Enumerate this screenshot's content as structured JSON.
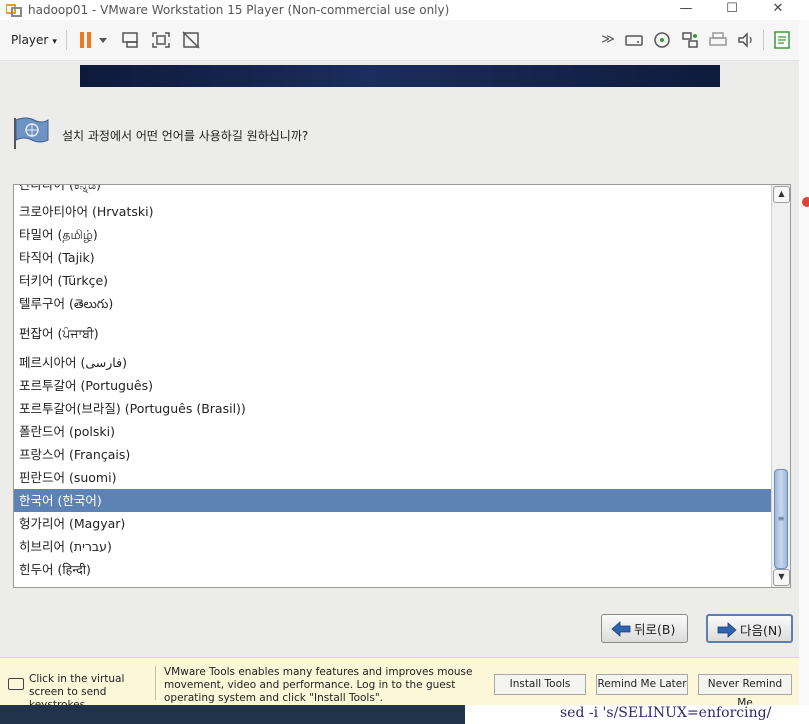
{
  "window": {
    "title": "hadoop01 - VMware Workstation 15 Player (Non-commercial use only)",
    "minimize_glyph": "—",
    "maximize_glyph": "☐",
    "close_glyph": "✕"
  },
  "toolbar": {
    "player_label": "Player",
    "player_caret": "▾",
    "icons": [
      "pause-icon",
      "pause-dropdown-icon",
      "send-ctrl-alt-del-icon",
      "fullscreen-icon",
      "unity-icon",
      "more-devices-icon",
      "hard-disk-icon",
      "cd-icon",
      "network-icon",
      "printer-icon",
      "sound-icon",
      "message-log-icon"
    ]
  },
  "installer": {
    "question": "설치 과정에서 어떤 언어를 사용하길 원하십니까?",
    "languages": [
      {
        "label": "칸나다어 (ಕನ್ನಡ)",
        "selected": false
      },
      {
        "label": "크로아티아어  (Hrvatski)",
        "selected": false
      },
      {
        "label": "타밀어 (தமிழ்)",
        "selected": false
      },
      {
        "label": "타직어 (Tajik)",
        "selected": false
      },
      {
        "label": "터키어 (Türkçe)",
        "selected": false
      },
      {
        "label": "텔루구어 (తెలుగు)",
        "selected": false
      },
      {
        "label": "펀잡어 (ਪੰਜਾਬੀ)",
        "selected": false
      },
      {
        "label": "페르시아어 (فارسی)",
        "selected": false
      },
      {
        "label": "포르투갈어 (Português)",
        "selected": false
      },
      {
        "label": "포르투갈어(브라질) (Português (Brasil))",
        "selected": false
      },
      {
        "label": "폴란드어 (polski)",
        "selected": false
      },
      {
        "label": "프랑스어   (Français)",
        "selected": false
      },
      {
        "label": "핀란드어   (suomi)",
        "selected": false
      },
      {
        "label": "한국어 (한국어)",
        "selected": true
      },
      {
        "label": "헝가리어   (Magyar)",
        "selected": false
      },
      {
        "label": "히브리어   (עברית)",
        "selected": false
      },
      {
        "label": "힌두어   (हिन्दी)",
        "selected": false
      }
    ],
    "back_label": "뒤로(B)",
    "next_label": "다음(N)"
  },
  "notification": {
    "click_hint": "Click in the virtual screen to send keystrokes",
    "message": "VMware Tools enables many features and improves mouse movement, video and performance. Log in to the guest operating system and click \"Install Tools\".",
    "install_label": "Install Tools",
    "remind_label": "Remind Me Later",
    "never_label": "Never Remind Me"
  },
  "host_background": {
    "code_text": "sed -i 's/SELINUX=enforcing/"
  },
  "colors": {
    "selection": "#5e82b4",
    "banner": "#1b2d5c",
    "notification_bg": "#fbf7d8",
    "pause_orange": "#f07820"
  }
}
